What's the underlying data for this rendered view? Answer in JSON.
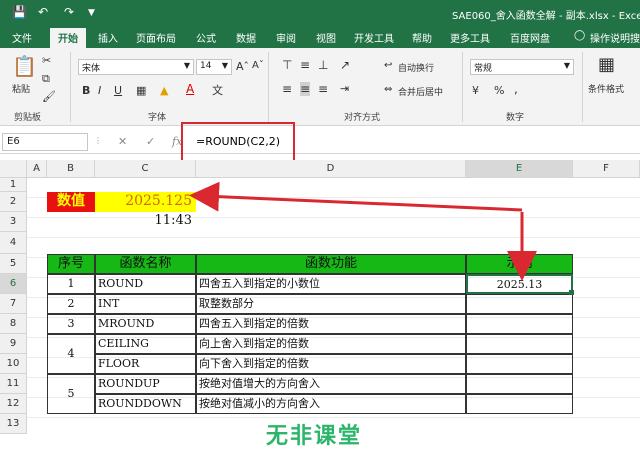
{
  "window": {
    "title": "SAE060_舍入函数全解 - 副本.xlsx  -  Excel"
  },
  "quick_access": [
    "save-icon",
    "undo-icon",
    "redo-icon"
  ],
  "tabs": [
    "文件",
    "开始",
    "插入",
    "页面布局",
    "公式",
    "数据",
    "审阅",
    "视图",
    "开发工具",
    "帮助",
    "更多工具",
    "百度网盘",
    "操作说明搜"
  ],
  "ribbon": {
    "paste": "粘贴",
    "clipboard_label": "剪贴板",
    "font_name": "宋体",
    "font_size": "14",
    "font_label": "字体",
    "bold": "B",
    "italic": "I",
    "underline": "U",
    "wrap": "自动换行",
    "merge": "合并后居中",
    "align_label": "对齐方式",
    "number_format": "常规",
    "percent": "%",
    "comma": ",",
    "number_label": "数字",
    "cond_format": "条件格式"
  },
  "formula_bar": {
    "name_box": "E6",
    "fx": "fx",
    "formula": "=ROUND(C2,2)"
  },
  "columns": [
    "A",
    "B",
    "C",
    "D",
    "E",
    "F"
  ],
  "rows": [
    "1",
    "2",
    "3",
    "4",
    "5",
    "6",
    "7",
    "8",
    "9",
    "10",
    "11",
    "12",
    "13"
  ],
  "sheet": {
    "b2": "数值",
    "c2": "2025.125",
    "c3": "11:43",
    "table_headers": [
      "序号",
      "函数名称",
      "函数功能",
      "示例"
    ],
    "table_rows": [
      {
        "no": "1",
        "name": "ROUND",
        "desc": "四舍五入到指定的小数位",
        "example": "2025.13"
      },
      {
        "no": "2",
        "name": "INT",
        "desc": "取整数部分",
        "example": ""
      },
      {
        "no": "3",
        "name": "MROUND",
        "desc": "四舍五入到指定的倍数",
        "example": ""
      },
      {
        "no": "4",
        "name": "CEILING",
        "desc": "向上舍入到指定的倍数",
        "example": ""
      },
      {
        "no": "",
        "name": "FLOOR",
        "desc": "向下舍入到指定的倍数",
        "example": ""
      },
      {
        "no": "5",
        "name": "ROUNDUP",
        "desc": "按绝对值增大的方向舍入",
        "example": ""
      },
      {
        "no": "",
        "name": "ROUNDDOWN",
        "desc": "按绝对值减小的方向舍入",
        "example": ""
      }
    ]
  },
  "watermark": "无非课堂",
  "colors": {
    "excel_green": "#217346",
    "header_green": "#16b816",
    "value_red": "#e8110f",
    "value_yellow": "#ffff00",
    "annotation_red": "#d9282f"
  }
}
